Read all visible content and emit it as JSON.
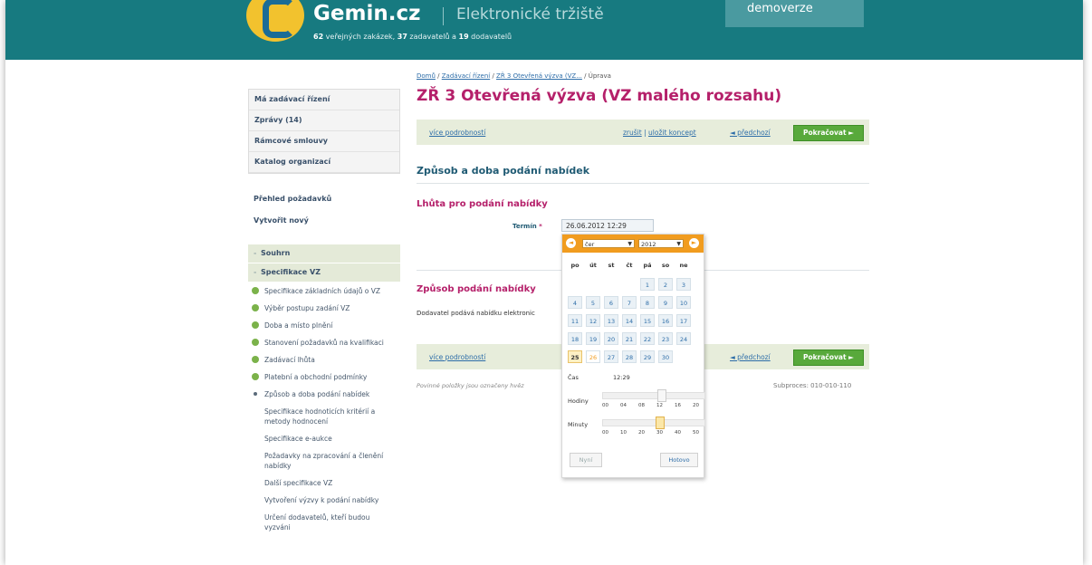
{
  "header": {
    "brand": "Gemin.cz",
    "subtitle": "Elektronické tržiště",
    "stats_public": "62",
    "stats_public_text": " veřejných zakázek, ",
    "stats_submitters": "37",
    "stats_submitters_text": " zadavatelů a ",
    "stats_suppliers": "19",
    "stats_suppliers_text": " dodavatelů",
    "demo": "demoverze"
  },
  "sidebar": {
    "main": [
      "Má zadávací řízení",
      "Zprávy (14)",
      "Rámcové smlouvy",
      "Katalog organizací"
    ],
    "links": [
      "Přehled požadavků",
      "Vytvořit nový"
    ],
    "sections": [
      "Souhrn",
      "Specifikace VZ"
    ],
    "items": [
      {
        "label": "Specifikace základních údajů o VZ",
        "state": "done"
      },
      {
        "label": "Výběr postupu zadání VZ",
        "state": "done"
      },
      {
        "label": "Doba a místo plnění",
        "state": "done"
      },
      {
        "label": "Stanovení požadavků na kvalifikaci",
        "state": "done"
      },
      {
        "label": "Zadávací lhůta",
        "state": "done"
      },
      {
        "label": "Platební a obchodní podmínky",
        "state": "done"
      },
      {
        "label": "Způsob a doba podání nabídek",
        "state": "current"
      },
      {
        "label": "Specifikace hodnoticích kritérií a metody hodnocení",
        "state": "todo"
      },
      {
        "label": "Specifikace e-aukce",
        "state": "todo"
      },
      {
        "label": "Požadavky na zpracování a členění nabídky",
        "state": "todo"
      },
      {
        "label": "Další specifikace VZ",
        "state": "todo"
      },
      {
        "label": "Vytvoření výzvy k podání nabídky",
        "state": "todo"
      },
      {
        "label": "Určení dodavatelů, kteří budou vyzváni",
        "state": "todo"
      }
    ]
  },
  "breadcrumb": {
    "home": "Domů",
    "sep": " / ",
    "proc": "Zadávací řízení",
    "item": "ZŘ 3 Otevřená výzva (VZ...",
    "current": "Úprava"
  },
  "title": "ZŘ 3 Otevřená výzva (VZ malého rozsahu)",
  "actionbar": {
    "more": "více podrobností",
    "cancel": "zrušit",
    "sep": " | ",
    "save_draft": "uložit koncept",
    "prev": "◄ předchozí",
    "continue": "Pokračovat ►"
  },
  "section_title": "Způsob a doba podání nabídek",
  "deadline_title": "Lhůta pro podání nabídky",
  "term_label": "Termín",
  "term_required": "*",
  "term_value": "26.06.2012 12:29",
  "method_title": "Způsob podání nabídky",
  "method_desc": "Dodavatel podává nabídku elektronic",
  "note": "Povinné položky jsou označeny hvěz",
  "subprocess": "Subproces: 010-010-110",
  "datepicker": {
    "prev_icon": "◄",
    "next_icon": "►",
    "month": "čer",
    "year": "2012",
    "dropdown_icon": "▼",
    "weekdays": [
      "po",
      "út",
      "st",
      "čt",
      "pá",
      "so",
      "ne"
    ],
    "weeks": [
      [
        "",
        "",
        "",
        "",
        "1",
        "2",
        "3"
      ],
      [
        "4",
        "5",
        "6",
        "7",
        "8",
        "9",
        "10"
      ],
      [
        "11",
        "12",
        "13",
        "14",
        "15",
        "16",
        "17"
      ],
      [
        "18",
        "19",
        "20",
        "21",
        "22",
        "23",
        "24"
      ],
      [
        "25",
        "26",
        "27",
        "28",
        "29",
        "30",
        ""
      ]
    ],
    "today": "25",
    "selected": "26",
    "time_label": "Čas",
    "time_value": "12:29",
    "hours_label": "Hodiny",
    "hours_ticks": [
      "00",
      "04",
      "08",
      "12",
      "16",
      "20"
    ],
    "hours_value": 12,
    "minutes_label": "Minuty",
    "minutes_ticks": [
      "00",
      "10",
      "20",
      "30",
      "40",
      "50"
    ],
    "minutes_value": 29,
    "now_btn": "Nyní",
    "done_btn": "Hotovo"
  }
}
